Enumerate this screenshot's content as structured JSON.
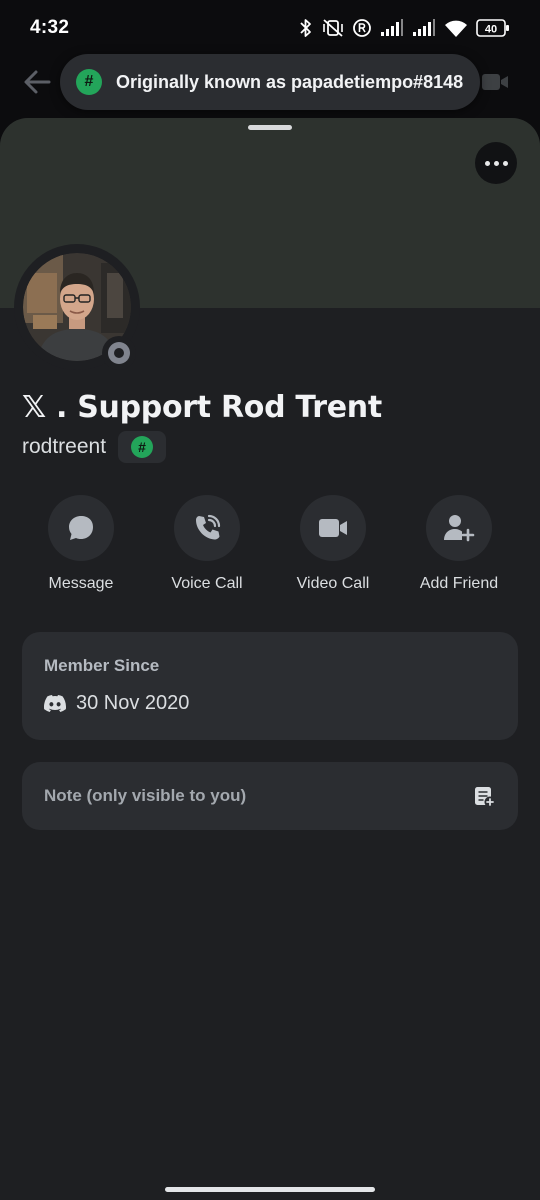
{
  "status_bar": {
    "time": "4:32",
    "battery": "40",
    "icons": [
      "bluetooth-icon",
      "mute-vibrate-icon",
      "registered-icon",
      "signal-icon",
      "signal-icon",
      "wifi-icon",
      "battery-icon"
    ]
  },
  "toast": {
    "badge": "#",
    "text": "Originally known as papadetiempo#8148"
  },
  "profile": {
    "display_name": "𝕏 . Support Rod Trent",
    "username": "rodtreent",
    "tag_badge": "#",
    "presence": "offline"
  },
  "actions": [
    {
      "label": "Message",
      "icon": "chat-bubble-icon"
    },
    {
      "label": "Voice Call",
      "icon": "phone-icon"
    },
    {
      "label": "Video Call",
      "icon": "video-camera-icon"
    },
    {
      "label": "Add Friend",
      "icon": "add-friend-icon"
    }
  ],
  "member_since": {
    "title": "Member Since",
    "date": "30 Nov 2020",
    "icon": "discord-logo-icon"
  },
  "note": {
    "placeholder": "Note (only visible to you)",
    "icon": "add-note-icon"
  },
  "colors": {
    "background": "#1e1f22",
    "card": "#2b2d31",
    "banner": "#2d322e",
    "accent_green": "#23a55a",
    "offline_gray": "#80848e"
  }
}
